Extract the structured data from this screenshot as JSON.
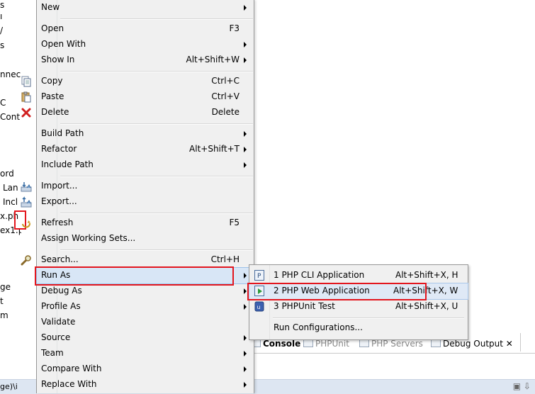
{
  "left_tree": {
    "fragments": [
      "s",
      "ı",
      "/",
      "s",
      "nnec",
      "C",
      "Cont",
      "ord",
      "Lan",
      "Incl",
      "x.ph",
      "ex1.p",
      "ge",
      "t",
      "m"
    ]
  },
  "bottom": {
    "left_text": "ge)\\i",
    "right_text": "▣ ⇩"
  },
  "background_views": {
    "tabs": [
      "Console",
      "PHPUnit",
      "PHP Servers",
      "Debug Output"
    ],
    "close_glyph": "✕"
  },
  "context_menu": {
    "items": [
      {
        "label": "New",
        "accel": "",
        "submenu": true
      },
      {
        "label": "Open",
        "accel": "F3",
        "submenu": false
      },
      {
        "label": "Open With",
        "accel": "",
        "submenu": true
      },
      {
        "label": "Show In",
        "accel": "Alt+Shift+W",
        "submenu": true
      },
      {
        "label": "Copy",
        "accel": "Ctrl+C",
        "submenu": false,
        "icon": "copy-icon"
      },
      {
        "label": "Paste",
        "accel": "Ctrl+V",
        "submenu": false,
        "icon": "paste-icon"
      },
      {
        "label": "Delete",
        "accel": "Delete",
        "submenu": false,
        "icon": "delete-icon"
      },
      {
        "label": "Build Path",
        "accel": "",
        "submenu": true
      },
      {
        "label": "Refactor",
        "accel": "Alt+Shift+T",
        "submenu": true
      },
      {
        "label": "Include Path",
        "accel": "",
        "submenu": true
      },
      {
        "label": "Import...",
        "accel": "",
        "submenu": false,
        "icon": "import-icon"
      },
      {
        "label": "Export...",
        "accel": "",
        "submenu": false,
        "icon": "export-icon"
      },
      {
        "label": "Refresh",
        "accel": "F5",
        "submenu": false,
        "icon": "refresh-icon"
      },
      {
        "label": "Assign Working Sets...",
        "accel": "",
        "submenu": false
      },
      {
        "label": "Search...",
        "accel": "Ctrl+H",
        "submenu": false,
        "icon": "search-icon"
      },
      {
        "label": "Run As",
        "accel": "",
        "submenu": true
      },
      {
        "label": "Debug As",
        "accel": "",
        "submenu": true
      },
      {
        "label": "Profile As",
        "accel": "",
        "submenu": true
      },
      {
        "label": "Validate",
        "accel": "",
        "submenu": false
      },
      {
        "label": "Source",
        "accel": "",
        "submenu": true
      },
      {
        "label": "Team",
        "accel": "",
        "submenu": true
      },
      {
        "label": "Compare With",
        "accel": "",
        "submenu": true
      },
      {
        "label": "Replace With",
        "accel": "",
        "submenu": true
      }
    ]
  },
  "run_as_submenu": {
    "items": [
      {
        "label": "1 PHP CLI Application",
        "accel": "Alt+Shift+X, H",
        "icon": "php-cli-icon"
      },
      {
        "label": "2 PHP Web Application",
        "accel": "Alt+Shift+X, W",
        "icon": "php-web-icon"
      },
      {
        "label": "3 PHPUnit Test",
        "accel": "Alt+Shift+X, U",
        "icon": "phpunit-icon"
      },
      {
        "label": "Run Configurations...",
        "accel": ""
      }
    ]
  },
  "colors": {
    "highlight": "#d8e6f6",
    "annotation_red": "#e3161e",
    "menu_bg": "#f0f0f0"
  }
}
